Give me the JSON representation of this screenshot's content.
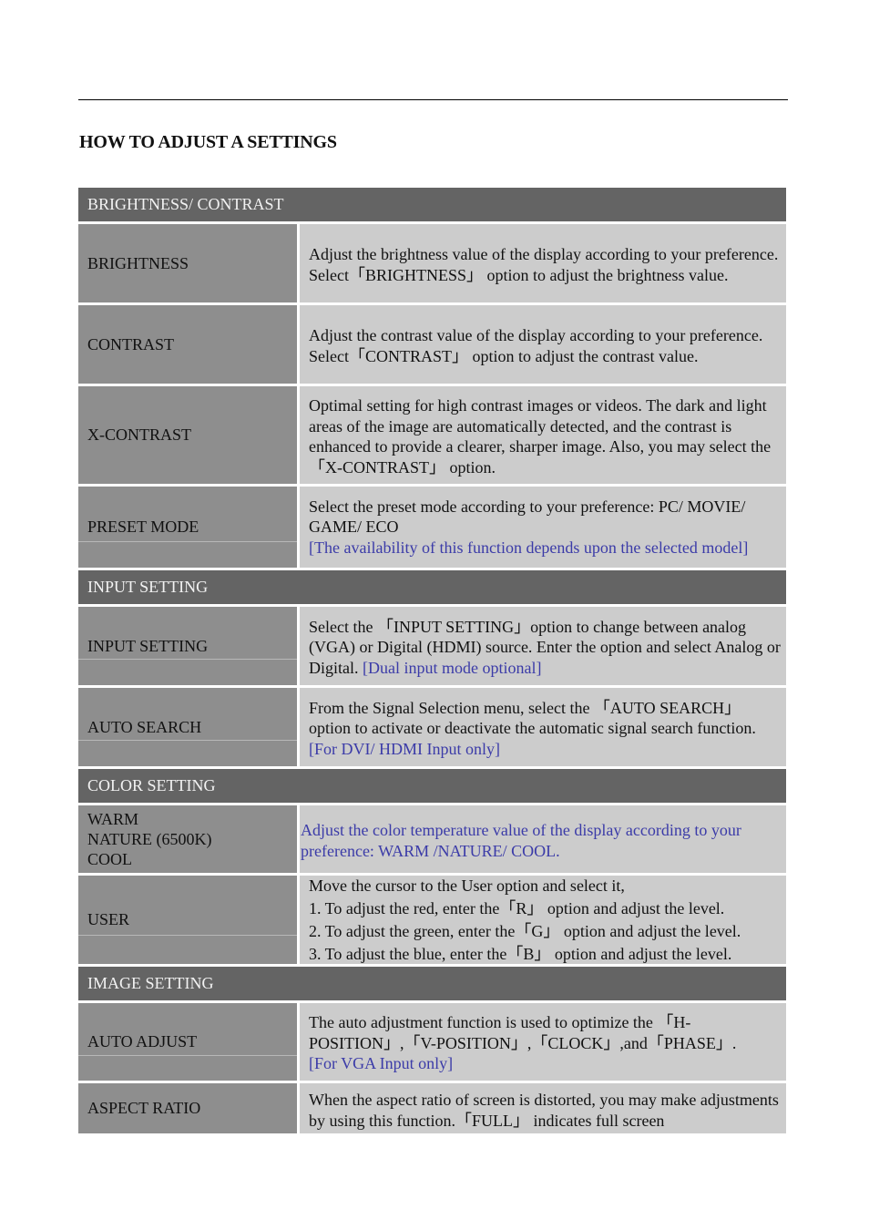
{
  "page": {
    "title": "HOW TO ADJUST A SETTINGS"
  },
  "sections": [
    {
      "header": "BRIGHTNESS/ CONTRAST",
      "rows": [
        {
          "label": "BRIGHTNESS",
          "text": "Adjust the brightness value of the display according to your preference. Select「BRIGHTNESS」 option to adjust the brightness value.",
          "note": ""
        },
        {
          "label": "CONTRAST",
          "text": "Adjust the contrast value of the display according to your preference. Select「CONTRAST」 option to adjust the contrast value.",
          "note": ""
        },
        {
          "label": "X-CONTRAST",
          "text": "Optimal setting for high contrast images or videos. The dark and light areas of the image are automatically detected, and the contrast is enhanced to provide a clearer, sharper image. Also, you may select the「X-CONTRAST」 option.",
          "note": ""
        },
        {
          "label": "PRESET MODE",
          "text": "Select the preset mode according to your preference: PC/ MOVIE/ GAME/ ECO",
          "note": "[The availability of this function depends upon the selected model]"
        }
      ]
    },
    {
      "header": "INPUT SETTING",
      "rows": [
        {
          "label": "INPUT SETTING",
          "text": "Select the 「INPUT SETTING」option to change between analog (VGA) or Digital (HDMI) source. Enter the option and select Analog or Digital.",
          "note": "[Dual input mode optional]"
        },
        {
          "label": "AUTO SEARCH",
          "text": "From the Signal Selection menu, select the 「AUTO SEARCH」 option to activate or deactivate the automatic signal search function.",
          "note": "[For DVI/ HDMI Input only]"
        }
      ]
    },
    {
      "header": "COLOR SETTING",
      "rows": [
        {
          "label_lines": [
            "WARM",
            "NATURE (6500K)",
            "COOL"
          ],
          "text": "",
          "note": "Adjust the color temperature value of the display according to your preference: WARM /NATURE/ COOL."
        },
        {
          "label": "USER",
          "lines": [
            "Move the cursor to the User option and select it,",
            "1. To adjust the red, enter the「R」 option and adjust the level.",
            "2. To adjust the green, enter the「G」 option and adjust the level.",
            "3. To adjust the blue, enter the「B」 option and adjust the level."
          ]
        }
      ]
    },
    {
      "header": "IMAGE SETTING",
      "rows": [
        {
          "label": "AUTO ADJUST",
          "text": "The auto adjustment function is used to optimize the 「H-POSITION」,「V-POSITION」,「CLOCK」,and「PHASE」.",
          "note": "[For VGA Input only]"
        },
        {
          "label": "ASPECT RATIO",
          "text": "When the aspect ratio of screen is distorted, you may make adjustments by using this function.「FULL」 indicates full screen",
          "note": ""
        }
      ]
    }
  ]
}
